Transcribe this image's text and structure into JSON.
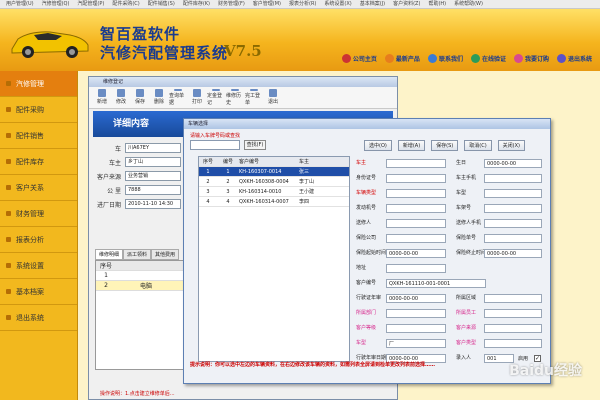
{
  "menu": [
    "用户管理(U)",
    "汽修管理(Q)",
    "汽配管理(P)",
    "配件采购(C)",
    "配件销售(S)",
    "配件库存(K)",
    "财务管理(F)",
    "客户管理(M)",
    "报表分析(R)",
    "系统设置(X)",
    "基本档案(J)",
    "客户资料(Z)",
    "帮助(H)",
    "系统帮助(W)"
  ],
  "brand": {
    "name": "智百盈软件",
    "title": "汽修汽配管理系统",
    "version": "V7.5"
  },
  "top_buttons": [
    "公司主页",
    "最新产品",
    "联系我们",
    "在线验证",
    "我要订购",
    "退出系统"
  ],
  "sidebar": [
    "汽修管理",
    "配件采购",
    "配件销售",
    "配件库存",
    "客户关系",
    "财务管理",
    "报表分析",
    "系统设置",
    "基本档案",
    "退出系统"
  ],
  "window": {
    "title": "维修登记",
    "toolbar": [
      "新增",
      "修改",
      "保存",
      "删除",
      "查询单据",
      "打印",
      "定金登记",
      "维修历史",
      "完工登单",
      "退出"
    ],
    "header": "详细内容",
    "fields": [
      {
        "label": "车",
        "value": "川A67EY"
      },
      {
        "label": "车主",
        "value": "乡丁山"
      },
      {
        "label": "客户来源",
        "value": "业务营销"
      },
      {
        "label": "公 里",
        "value": "7888"
      },
      {
        "label": "进厂日期",
        "value": "2010-11-10 14:30"
      }
    ],
    "tabs": [
      "维修明细",
      "派工领料",
      "其他费用"
    ],
    "grid_header": [
      "序号"
    ],
    "grid_rows": [
      [
        "1",
        ""
      ],
      [
        "2",
        "电脑"
      ]
    ],
    "bottom_hint": "操作说明：1.点击建立维修单后..."
  },
  "dialog": {
    "title": "车辆选择",
    "hint": "请输入车牌号码或查找",
    "search_btn": "查找(F)",
    "buttons": [
      "选中(O)",
      "新增(A)",
      "保存(S)",
      "取消(C)",
      "关闭(X)"
    ],
    "list_header": [
      "序号",
      "编号",
      "客户编号",
      "车主"
    ],
    "list_rows": [
      [
        "1",
        "1",
        "KH-160307-0014",
        "张三"
      ],
      [
        "2",
        "2",
        "QXKH-160308-0004",
        "李丁山"
      ],
      [
        "3",
        "3",
        "KH-160314-0010",
        "王小建"
      ],
      [
        "4",
        "4",
        "QXKH-160314-0007",
        "李四"
      ]
    ],
    "form": {
      "plate_label": "车主",
      "plate_value": "",
      "id_label": "身份证号",
      "car_type_label": "车辆类型",
      "engine_label": "发动机号",
      "contact_label": "送修人",
      "insurer_label": "保险公司",
      "insure_date_label": "保险起始时间",
      "insure_date": "0000-00-00",
      "address_label": "地址",
      "customer_no_label": "客户编号",
      "customer_no": "QXKH-161110-001-0001",
      "driving_date_label": "行驶证年审",
      "driving_date": "0000-00-00",
      "dept_label": "所属部门",
      "org_label": "客户等级",
      "brand_label": "车型",
      "brand_value": "厂",
      "annual_label": "行驶年审日期",
      "annual_date": "0000-00-00",
      "born_label": "生日",
      "born": "0000-00-00",
      "phone_label": "车主手机",
      "model_label": "车型",
      "vin_label": "车架号",
      "sender_phone_label": "送修人手机",
      "insure_no_label": "保险单号",
      "insure_end_label": "保险终止时间",
      "insure_end": "0000-00-00",
      "region_label": "所属区域",
      "staff_label": "所属员工",
      "source_label": "客户来源",
      "age_label": "客户类型",
      "entry_label": "录入人",
      "entry_value": "001",
      "enable_label": "启用"
    },
    "footer": "提示说明：你可以选中左边的车辆资料，在右边修改该车辆的资料，如需列表全屏请到检单更改列表前选择……"
  },
  "watermark": "Baidu经验"
}
